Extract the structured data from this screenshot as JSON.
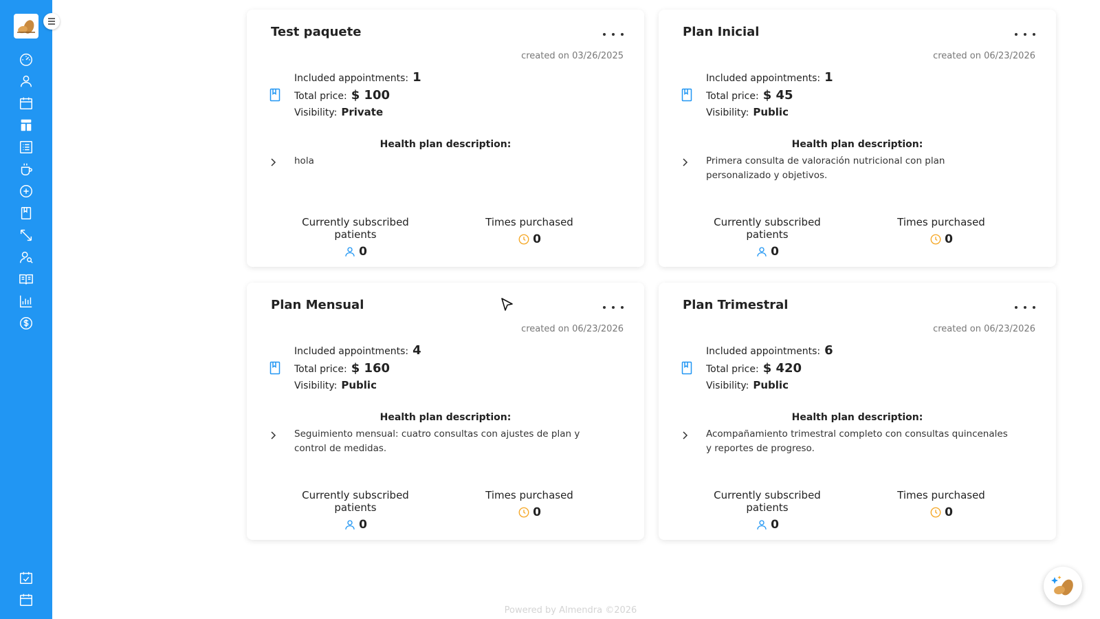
{
  "sidebar": {
    "nav_top": [
      "dashboard-icon",
      "user-icon",
      "calendar-icon",
      "layout-icon",
      "list-icon",
      "coffee-icon",
      "add-circle-icon",
      "book-icon",
      "resize-icon",
      "users-icon",
      "open-book-icon",
      "bar-chart-icon",
      "dollar-icon"
    ],
    "nav_bottom": [
      "calendar-check-icon",
      "calendar-icon"
    ]
  },
  "labels": {
    "included": "Included appointments:",
    "total": "Total price:",
    "visibility": "Visibility:",
    "desc_title": "Health plan description:",
    "subscribed": "Currently subscribed patients",
    "times": "Times purchased"
  },
  "plans": [
    {
      "title": "Test paquete",
      "created": "created on 03/26/2025",
      "appointments": "1",
      "price": "$ 100",
      "visibility": "Private",
      "description": "hola",
      "subscribed": "0",
      "times": "0"
    },
    {
      "title": "Plan Inicial",
      "created": "created on 06/23/2026",
      "appointments": "1",
      "price": "$ 45",
      "visibility": "Public",
      "description": "Primera consulta de valoración nutricional con plan personalizado y objetivos.",
      "subscribed": "0",
      "times": "0"
    },
    {
      "title": "Plan Mensual",
      "created": "created on 06/23/2026",
      "appointments": "4",
      "price": "$ 160",
      "visibility": "Public",
      "description": "Seguimiento mensual: cuatro consultas con ajustes de plan y control de medidas.",
      "subscribed": "0",
      "times": "0"
    },
    {
      "title": "Plan Trimestral",
      "created": "created on 06/23/2026",
      "appointments": "6",
      "price": "$ 420",
      "visibility": "Public",
      "description": "Acompañamiento trimestral completo con consultas quincenales y reportes de progreso.",
      "subscribed": "0",
      "times": "0"
    }
  ],
  "footer": "Powered by Almendra ©2026",
  "colors": {
    "sidebar": "#2196f3",
    "accent_blue": "#2196f3",
    "accent_orange": "#f5a623"
  }
}
